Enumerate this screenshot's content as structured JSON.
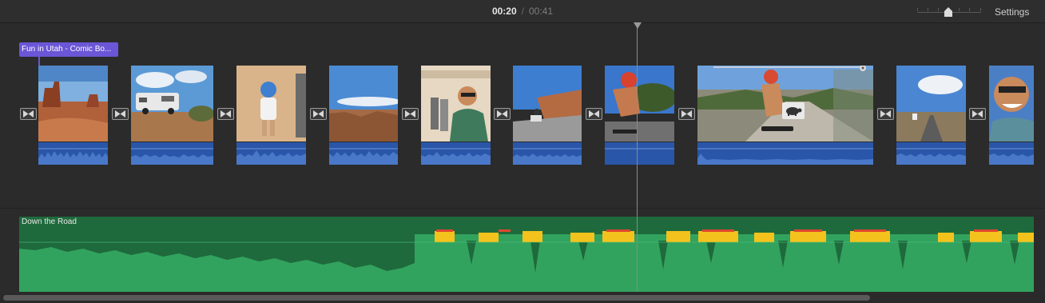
{
  "header": {
    "current_time": "00:20",
    "separator": "/",
    "total_time": "00:41",
    "settings_label": "Settings"
  },
  "timeline": {
    "title_clip": "Fun in Utah - Comic Bo...",
    "playhead_time": "00:20",
    "clips": [
      {
        "scene": "monument-valley-buttes"
      },
      {
        "scene": "rv-in-desert"
      },
      {
        "scene": "child-in-sand"
      },
      {
        "scene": "canyon-overlook"
      },
      {
        "scene": "family-at-trading-post"
      },
      {
        "scene": "longboarder-on-road"
      },
      {
        "scene": "longboarder-closeup"
      },
      {
        "scene": "longboarder-downhill"
      },
      {
        "scene": "desert-highway"
      },
      {
        "scene": "smiling-man-selfie"
      }
    ],
    "slow_motion_icon": "tortoise-icon",
    "transition_icon": "bowtie-transition-icon"
  },
  "music": {
    "track_name": "Down the Road"
  },
  "colors": {
    "audio_clip": "#2956a8",
    "music_dark": "#1e6a3c",
    "music_wave": "#32a35e",
    "peak_yellow": "#f4c21c",
    "peak_red": "#e0462f",
    "title_purple": "#6a56d6"
  }
}
